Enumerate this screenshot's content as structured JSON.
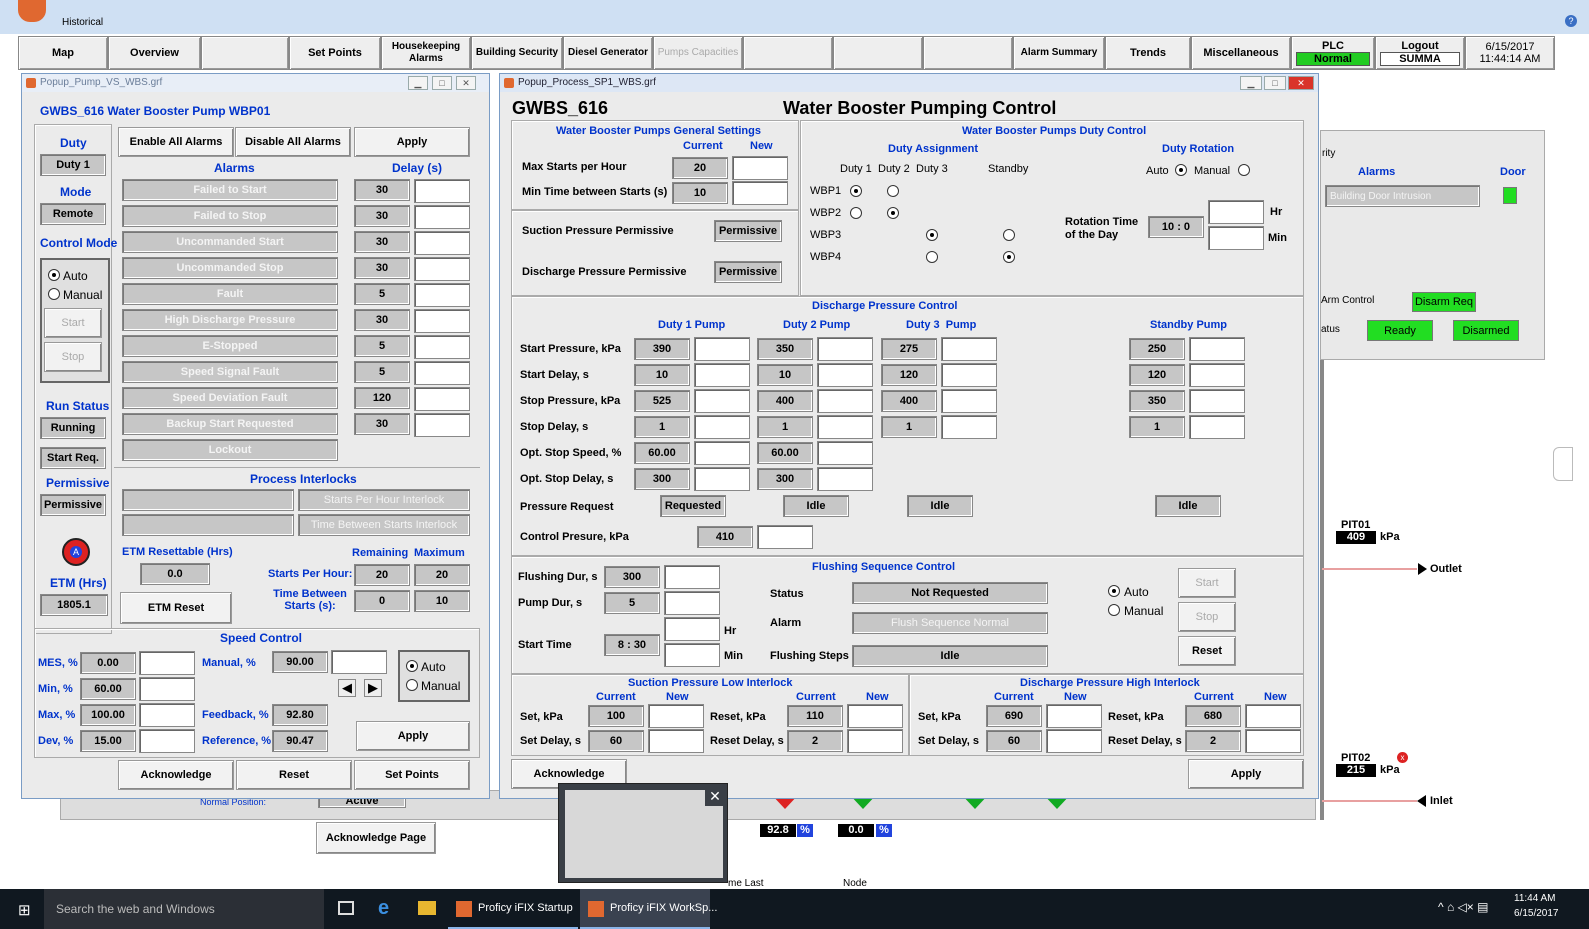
{
  "app": {
    "tab": "Historical"
  },
  "topnav": {
    "map": "Map",
    "overview": "Overview",
    "setpoints": "Set Points",
    "housekeeping": "Housekeeping Alarms",
    "building": "Building Security",
    "diesel": "Diesel Generator",
    "pumps": "Pumps Capacities",
    "alarm_summary": "Alarm Summary",
    "trends": "Trends",
    "misc": "Miscellaneous",
    "plc_label": "PLC",
    "plc_status": "Normal",
    "logout": "Logout",
    "user": "SUMMA",
    "date": "6/15/2017",
    "time": "11:44:14 AM"
  },
  "pump_win": {
    "title": "Popup_Pump_VS_WBS.grf",
    "header": "GWBS_616 Water Booster Pump WBP01",
    "duty_label": "Duty",
    "duty": "Duty 1",
    "mode_label": "Mode",
    "mode": "Remote",
    "control_mode": "Control Mode",
    "auto": "Auto",
    "manual": "Manual",
    "start": "Start",
    "stop": "Stop",
    "run_status_label": "Run Status",
    "run_status": "Running",
    "start_req": "Start Req.",
    "permissive_label": "Permissive",
    "permissive": "Permissive",
    "etm_label": "ETM (Hrs)",
    "etm": "1805.1",
    "enable_all": "Enable All Alarms",
    "disable_all": "Disable All Alarms",
    "apply": "Apply",
    "alarms_hdr": "Alarms",
    "delay_hdr": "Delay (s)",
    "alarms": [
      {
        "name": "Failed to Start",
        "delay": "30"
      },
      {
        "name": "Failed to Stop",
        "delay": "30"
      },
      {
        "name": "Uncommanded Start",
        "delay": "30"
      },
      {
        "name": "Uncommanded Stop",
        "delay": "30"
      },
      {
        "name": "Fault",
        "delay": "5"
      },
      {
        "name": "High Discharge Pressure",
        "delay": "30"
      },
      {
        "name": "E-Stopped",
        "delay": "5"
      },
      {
        "name": "Speed Signal Fault",
        "delay": "5"
      },
      {
        "name": "Speed Deviation Fault",
        "delay": "120"
      },
      {
        "name": "Backup Start Requested",
        "delay": "30"
      },
      {
        "name": "Lockout",
        "delay": ""
      }
    ],
    "interlocks_hdr": "Process Interlocks",
    "sph_interlock": "Starts Per Hour Interlock",
    "tbs_interlock": "Time Between Starts Interlock",
    "etm_resettable": "ETM Resettable (Hrs)",
    "etm_resettable_val": "0.0",
    "etm_reset": "ETM Reset",
    "remaining": "Remaining",
    "maximum": "Maximum",
    "starts_per_hour": "Starts Per Hour:",
    "sph_rem": "20",
    "sph_max": "20",
    "time_between": "Time Between Starts (s):",
    "tbs_rem": "0",
    "tbs_max": "10",
    "speed_hdr": "Speed Control",
    "mes": "MES, %",
    "mes_val": "0.00",
    "min": "Min, %",
    "min_val": "60.00",
    "max": "Max, %",
    "max_val": "100.00",
    "dev": "Dev, %",
    "dev_val": "15.00",
    "manual_pct": "Manual, %",
    "manual_val": "90.00",
    "feedback": "Feedback, %",
    "feedback_val": "92.80",
    "reference": "Reference, %",
    "reference_val": "90.47",
    "acknowledge": "Acknowledge",
    "reset": "Reset",
    "set_points": "Set Points"
  },
  "proc_win": {
    "title": "Popup_Process_SP1_WBS.grf",
    "station": "GWBS_616",
    "heading": "Water Booster Pumping Control",
    "gen_hdr": "Water Booster Pumps General Settings",
    "current": "Current",
    "new": "New",
    "max_starts": "Max Starts per Hour",
    "max_starts_val": "20",
    "min_time": "Min Time between Starts (s)",
    "min_time_val": "10",
    "suction_perm": "Suction Pressure Permissive",
    "suction_perm_val": "Permissive",
    "disch_perm": "Discharge Pressure Permissive",
    "disch_perm_val": "Permissive",
    "duty_ctrl_hdr": "Water Booster Pumps Duty Control",
    "duty_assign": "Duty Assignment",
    "duty_rotation": "Duty Rotation",
    "d1": "Duty 1",
    "d2": "Duty 2",
    "d3": "Duty 3",
    "standby": "Standby",
    "auto": "Auto",
    "manual": "Manual",
    "wbp1": "WBP1",
    "wbp2": "WBP2",
    "wbp3": "WBP3",
    "wbp4": "WBP4",
    "rotation_time": "Rotation Time of the Day",
    "rot_val": "10 : 0",
    "hr": "Hr",
    "min": "Min",
    "dpc_hdr": "Discharge Pressure Control",
    "duty1_pump": "Duty 1 Pump",
    "duty2_pump": "Duty 2 Pump",
    "duty3_pump": "Duty 3  Pump",
    "standby_pump": "Standby Pump",
    "rows": [
      {
        "label": "Start Pressure, kPa",
        "v": [
          "390",
          "350",
          "275",
          "250"
        ]
      },
      {
        "label": "Start Delay, s",
        "v": [
          "10",
          "10",
          "120",
          "120"
        ]
      },
      {
        "label": "Stop Pressure, kPa",
        "v": [
          "525",
          "400",
          "400",
          "350"
        ]
      },
      {
        "label": "Stop Delay, s",
        "v": [
          "1",
          "1",
          "1",
          "1"
        ]
      },
      {
        "label": "Opt. Stop Speed, %",
        "v": [
          "60.00",
          "60.00",
          "",
          ""
        ]
      },
      {
        "label": "Opt. Stop Delay, s",
        "v": [
          "300",
          "300",
          "",
          ""
        ]
      }
    ],
    "pressure_request": "Pressure Request",
    "pr": [
      "Requested",
      "Idle",
      "Idle",
      "Idle"
    ],
    "control_pressure": "Control Presure, kPa",
    "cp_val": "410",
    "flush_hdr": "Flushing Sequence Control",
    "flush_dur": "Flushing Dur, s",
    "flush_dur_val": "300",
    "pump_dur": "Pump Dur, s",
    "pump_dur_val": "5",
    "start_time": "Start Time",
    "start_time_val": "8 : 30",
    "status": "Status",
    "status_val": "Not Requested",
    "alarm": "Alarm",
    "alarm_val": "Flush Sequence Normal",
    "flushing_steps": "Flushing Steps",
    "steps_val": "Idle",
    "start": "Start",
    "stop": "Stop",
    "reset": "Reset",
    "spl_hdr": "Suction Pressure Low Interlock",
    "dph_hdr": "Discharge Pressure High Interlock",
    "set_kpa": "Set, kPa",
    "set_delay": "Set Delay, s",
    "reset_kpa": "Reset, kPa",
    "reset_delay": "Reset Delay, s",
    "spl": {
      "set": "100",
      "setd": "60",
      "reset": "110",
      "resetd": "2"
    },
    "dph": {
      "set": "690",
      "setd": "60",
      "reset": "680",
      "resetd": "2"
    },
    "acknowledge": "Acknowledge",
    "apply": "Apply"
  },
  "bg": {
    "rity": "rity",
    "alarms": "Alarms",
    "door": "Door",
    "intrusion": "Building Door Intrusion",
    "arm_control": "Arm Control",
    "disarm_req": "Disarm Req",
    "atus": "atus",
    "ready": "Ready",
    "disarmed": "Disarmed",
    "pit01": "PIT01",
    "pit01_val": "409",
    "kpa": "kPa",
    "outlet": "Outlet",
    "pit02": "PIT02",
    "pit02_val": "215",
    "inlet": "Inlet",
    "v1": "92.8",
    "v2": "0.0",
    "pct": "%",
    "ack_page": "Acknowledge Page",
    "active": "Active",
    "normal_pos": "Normal Position:",
    "node": "Node",
    "time_last": "me Last"
  },
  "taskbar": {
    "search": "Search the web and Windows",
    "app1": "Proficy iFIX Startup",
    "app2": "Proficy iFIX WorkSp...",
    "time": "11:44 AM",
    "date": "6/15/2017"
  }
}
